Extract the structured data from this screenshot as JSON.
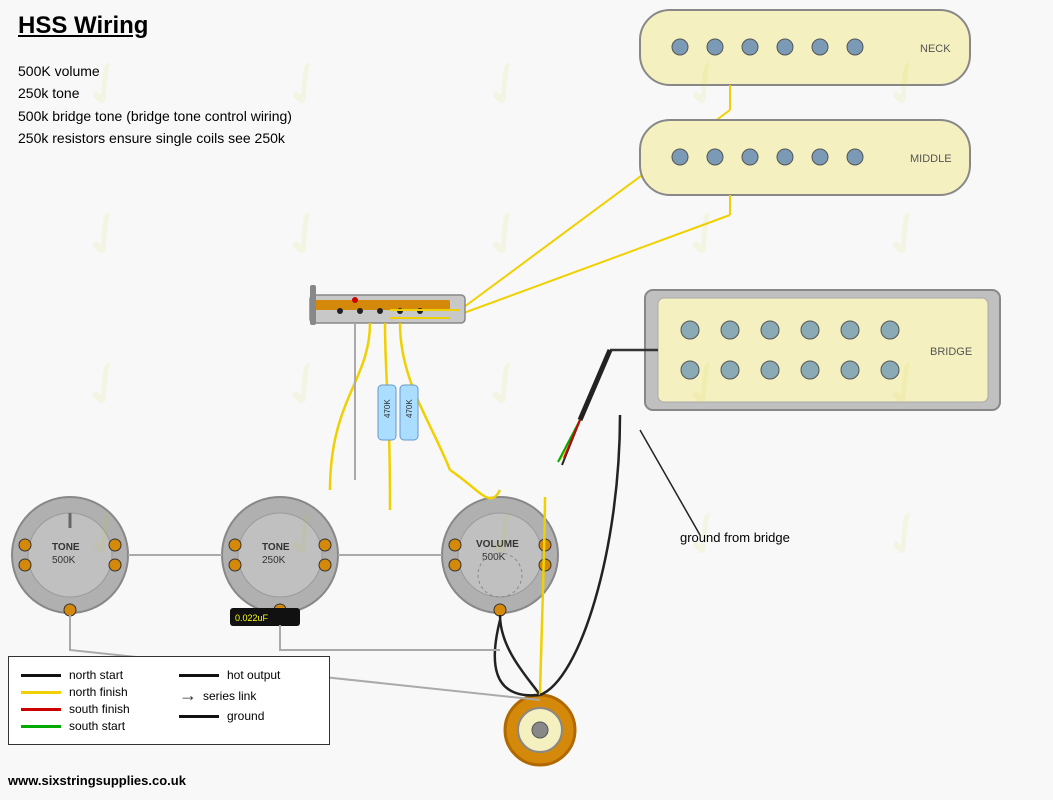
{
  "title": "HSS Wiring",
  "info": {
    "line1": "500K volume",
    "line2": "250k tone",
    "line3": "500k bridge tone (bridge tone control wiring)",
    "line4": "250k resistors ensure single coils see 250k"
  },
  "legend": {
    "items_left": [
      {
        "color": "#111111",
        "label": "north start"
      },
      {
        "color": "#f0d000",
        "label": "north finish"
      },
      {
        "color": "#cc0000",
        "label": "south finish"
      },
      {
        "color": "#00aa00",
        "label": "south start"
      }
    ],
    "items_right": [
      {
        "color": "#111111",
        "label": "hot output"
      },
      {
        "color": "transparent",
        "label": "series link",
        "arrow": true
      },
      {
        "color": "#111111",
        "label": "ground"
      }
    ]
  },
  "labels": {
    "neck": "NECK",
    "middle": "MIDDLE",
    "bridge": "BRIDGE",
    "tone1": "TONE\n500K",
    "tone2": "TONE\n250K",
    "volume": "VOLUME\n500K",
    "cap": "0.022uF",
    "resistor1": "470K",
    "resistor2": "470K",
    "ground_bridge": "ground from bridge"
  },
  "website": "www.sixstringsupplies.co.uk",
  "colors": {
    "accent": "#cccc00",
    "background": "#f8f8f8"
  }
}
